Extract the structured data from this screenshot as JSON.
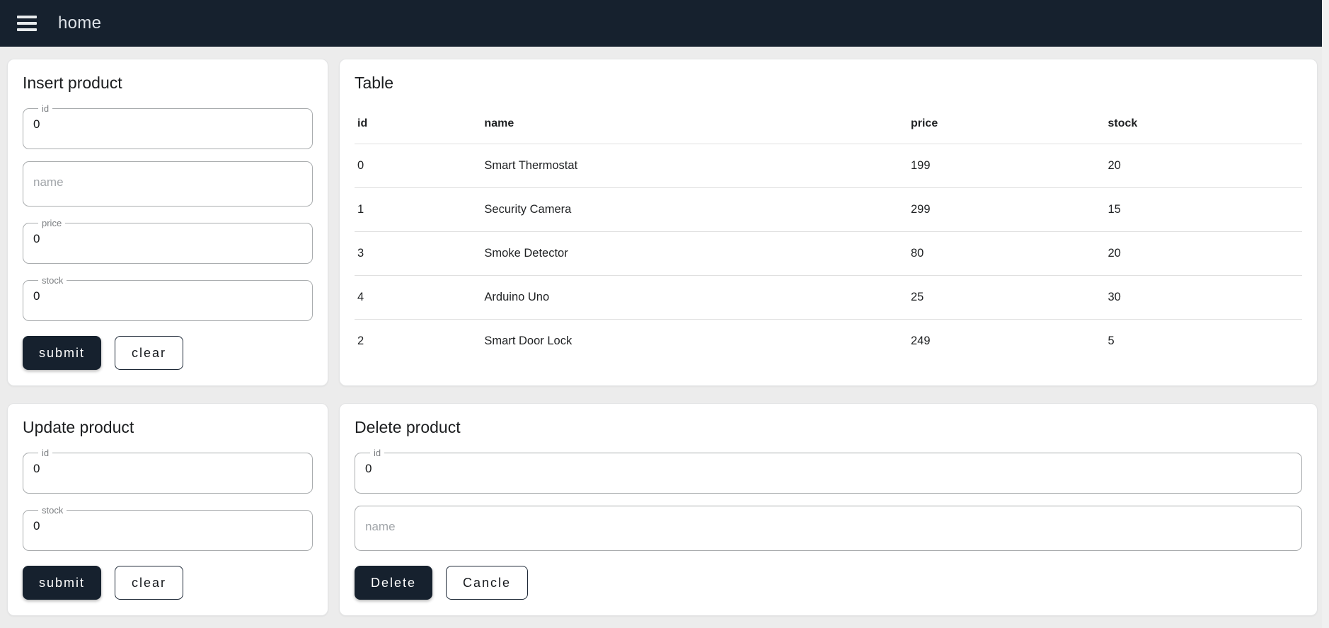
{
  "colors": {
    "navy": "#16212E",
    "page_bg": "#ECECEC"
  },
  "navbar": {
    "title": "home",
    "menu_icon": "hamburger-menu"
  },
  "insert_card": {
    "title": "Insert product",
    "fields": [
      {
        "label": "id",
        "value": "0",
        "placeholder": ""
      },
      {
        "label": "",
        "value": "",
        "placeholder": "name"
      },
      {
        "label": "price",
        "value": "0",
        "placeholder": ""
      },
      {
        "label": "stock",
        "value": "0",
        "placeholder": ""
      }
    ],
    "submit_label": "submit",
    "clear_label": "clear"
  },
  "table_card": {
    "title": "Table",
    "columns": [
      "id",
      "name",
      "price",
      "stock"
    ],
    "rows": [
      [
        "0",
        "Smart Thermostat",
        "199",
        "20"
      ],
      [
        "1",
        "Security Camera",
        "299",
        "15"
      ],
      [
        "3",
        "Smoke Detector",
        "80",
        "20"
      ],
      [
        "4",
        "Arduino Uno",
        "25",
        "30"
      ],
      [
        "2",
        "Smart Door Lock",
        "249",
        "5"
      ]
    ]
  },
  "update_card": {
    "title": "Update product",
    "fields": [
      {
        "label": "id",
        "value": "0",
        "placeholder": ""
      },
      {
        "label": "stock",
        "value": "0",
        "placeholder": ""
      }
    ],
    "submit_label": "submit",
    "clear_label": "clear"
  },
  "delete_card": {
    "title": "Delete product",
    "fields": [
      {
        "label": "id",
        "value": "0",
        "placeholder": ""
      },
      {
        "label": "",
        "value": "",
        "placeholder": "name"
      }
    ],
    "delete_label": "Delete",
    "cancel_label": "Cancle"
  }
}
